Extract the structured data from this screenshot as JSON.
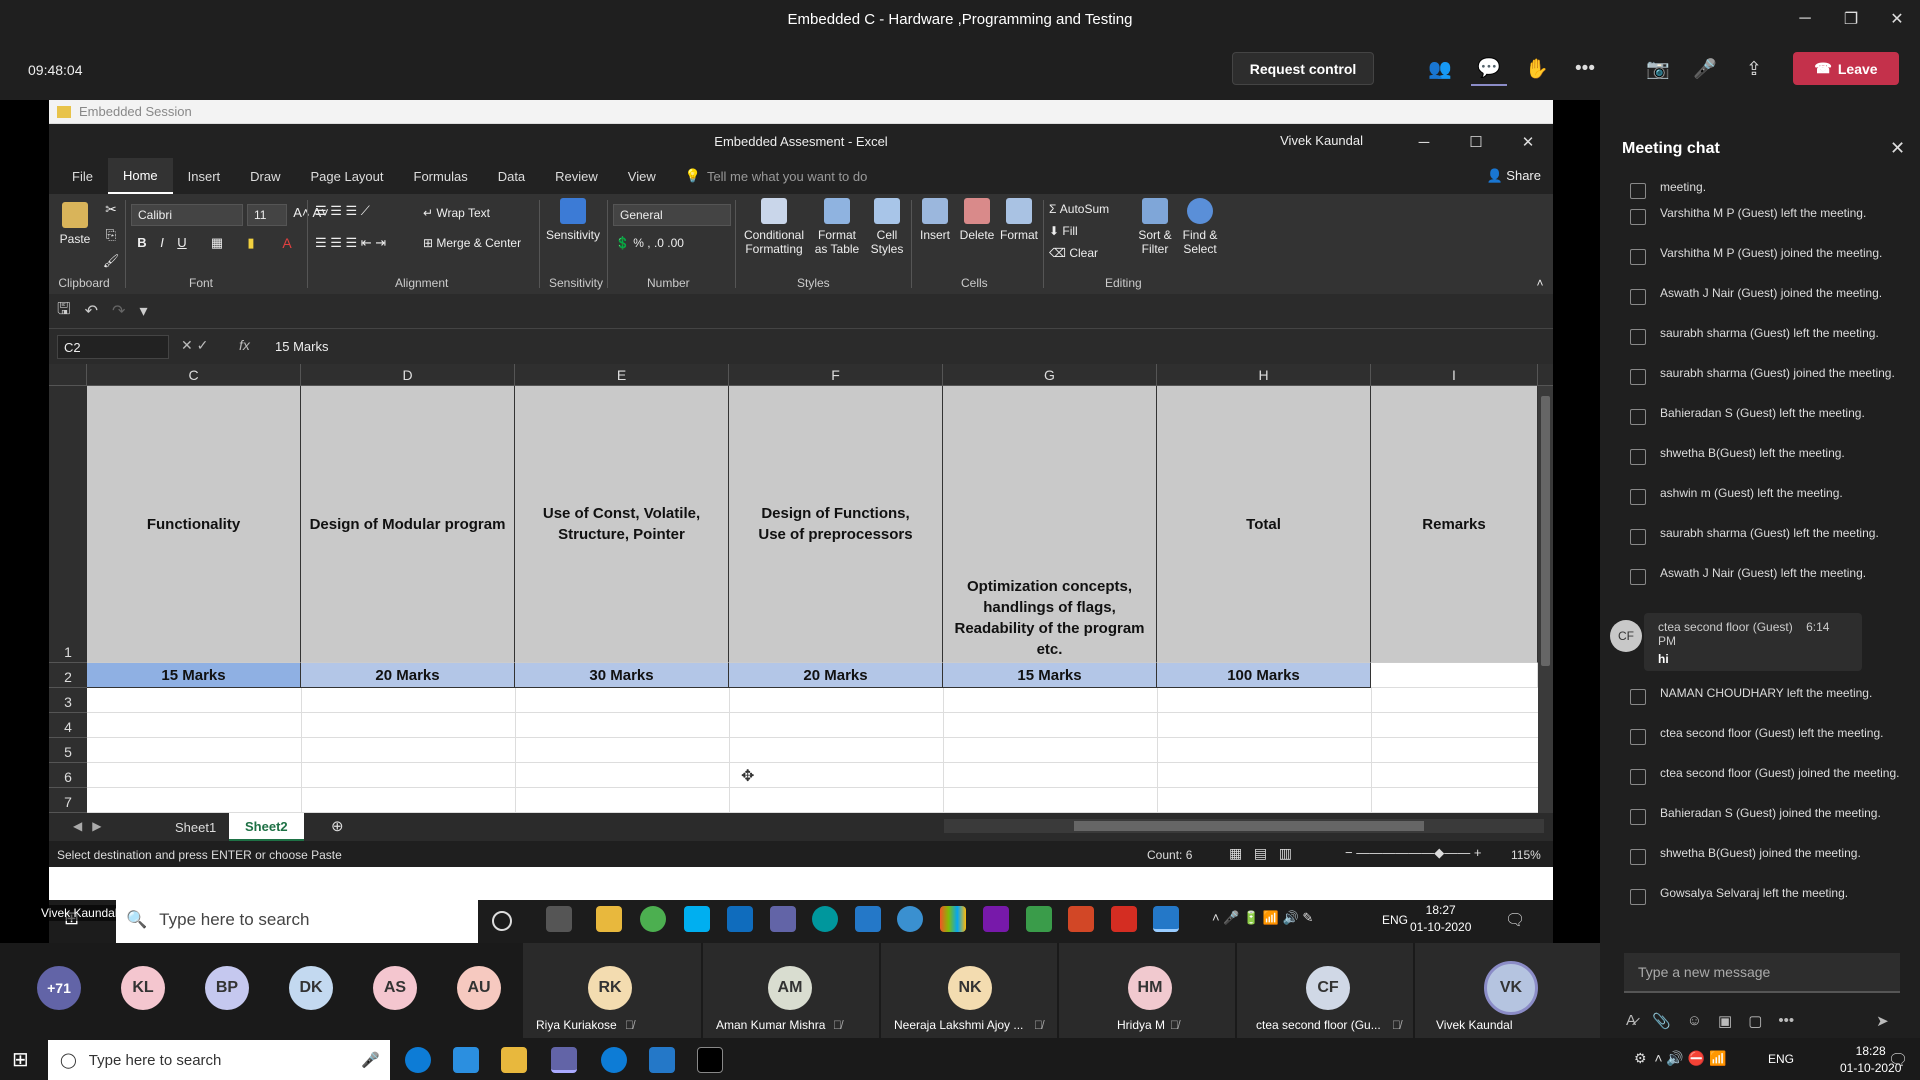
{
  "window": {
    "title": "Embedded C - Hardware ,Programming and Testing"
  },
  "meeting": {
    "clock": "09:48:04",
    "request_control": "Request control",
    "leave": "Leave"
  },
  "excel": {
    "qa_title": "Embedded Session",
    "title": "Embedded Assesment  -  Excel",
    "user": "Vivek Kaundal",
    "tabs": [
      "File",
      "Home",
      "Insert",
      "Draw",
      "Page Layout",
      "Formulas",
      "Data",
      "Review",
      "View"
    ],
    "tell_me": "Tell me what you want to do",
    "share": "Share",
    "ribbon": {
      "paste": "Paste",
      "font_name": "Calibri",
      "font_size": "11",
      "wrap_text": "Wrap Text",
      "merge_center": "Merge & Center",
      "sensitivity": "Sensitivity",
      "number_format": "General",
      "conditional_formatting": "Conditional Formatting",
      "format_as_table": "Format as Table",
      "cell_styles": "Cell Styles",
      "insert": "Insert",
      "delete": "Delete",
      "format": "Format",
      "autosum": "AutoSum",
      "fill": "Fill",
      "clear": "Clear",
      "sort_filter": "Sort & Filter",
      "find_select": "Find & Select",
      "groups": {
        "clipboard": "Clipboard",
        "font": "Font",
        "alignment": "Alignment",
        "sensitivity": "Sensitivity",
        "number": "Number",
        "styles": "Styles",
        "cells": "Cells",
        "editing": "Editing"
      }
    },
    "name_box": "C2",
    "formula_value": "15 Marks",
    "columns": [
      "C",
      "D",
      "E",
      "F",
      "G",
      "H",
      "I"
    ],
    "rows": [
      "1",
      "2",
      "3",
      "4",
      "5",
      "6",
      "7"
    ],
    "header_row": [
      "Functionality",
      "Design of Modular program",
      "Use of Const, Volatile, Structure, Pointer",
      "Design of Functions, Use of preprocessors",
      "Optimization concepts, handlings of flags, Readability of the program etc.",
      "Total",
      "Remarks"
    ],
    "marks_row": [
      "15 Marks",
      "20 Marks",
      "30 Marks",
      "20 Marks",
      "15 Marks",
      "100 Marks",
      ""
    ],
    "sheets": [
      "Sheet1",
      "Sheet2"
    ],
    "status": "Select destination and press ENTER or choose Paste",
    "count": "Count: 6",
    "zoom": "115%"
  },
  "inner_taskbar": {
    "presenter_label": "Vivek Kaundal",
    "search": "Type here to search",
    "time": "18:27",
    "date": "01-10-2020",
    "lang": "ENG"
  },
  "chat": {
    "title": "Meeting chat",
    "messages": [
      "meeting.",
      "Varshitha M P (Guest) left the meeting.",
      "Varshitha M P (Guest) joined the meeting.",
      "Aswath J Nair (Guest) joined the meeting.",
      "saurabh sharma (Guest) left the meeting.",
      "saurabh sharma (Guest) joined the meeting.",
      "Bahieradan S (Guest) left the meeting.",
      "shwetha B(Guest) left the meeting.",
      "ashwin m (Guest) left the meeting.",
      "saurabh sharma (Guest) left the meeting.",
      "Aswath J Nair (Guest) left the meeting."
    ],
    "bubble": {
      "initials": "CF",
      "sender": "ctea second floor (Guest)",
      "time": "6:14 PM",
      "text": "hi"
    },
    "messages2": [
      "NAMAN CHOUDHARY left the meeting.",
      "ctea second floor (Guest) left the meeting.",
      "ctea second floor (Guest) joined the meeting.",
      "Bahieradan S (Guest) joined the meeting.",
      "shwetha B(Guest) joined the meeting.",
      "Gowsalya Selvaraj left the meeting."
    ],
    "input_placeholder": "Type a new message"
  },
  "participants": {
    "small": [
      {
        "initials": "+71",
        "color": "#6264a7"
      },
      {
        "initials": "KL",
        "color": "#f4c6cf"
      },
      {
        "initials": "BP",
        "color": "#c5c8ef"
      },
      {
        "initials": "DK",
        "color": "#c3d9f0"
      },
      {
        "initials": "AS",
        "color": "#f4c6cf"
      },
      {
        "initials": "AU",
        "color": "#f6c9c0"
      }
    ],
    "tiles": [
      {
        "initials": "RK",
        "name": "Riya Kuriakose",
        "color": "#f3dcb0"
      },
      {
        "initials": "AM",
        "name": "Aman Kumar Mishra",
        "color": "#d9ddd0"
      },
      {
        "initials": "NK",
        "name": "Neeraja Lakshmi Ajoy ...",
        "color": "#f3dcb0"
      },
      {
        "initials": "HM",
        "name": "Hridya M",
        "color": "#f1c9cf"
      },
      {
        "initials": "CF",
        "name": "ctea second floor (Gu...",
        "color": "#d0d8e6"
      },
      {
        "initials": "VK",
        "name": "Vivek Kaundal",
        "color": "#b5c4e0"
      }
    ]
  },
  "os": {
    "search": "Type here to search",
    "time": "18:28",
    "date": "01-10-2020",
    "lang": "ENG"
  }
}
